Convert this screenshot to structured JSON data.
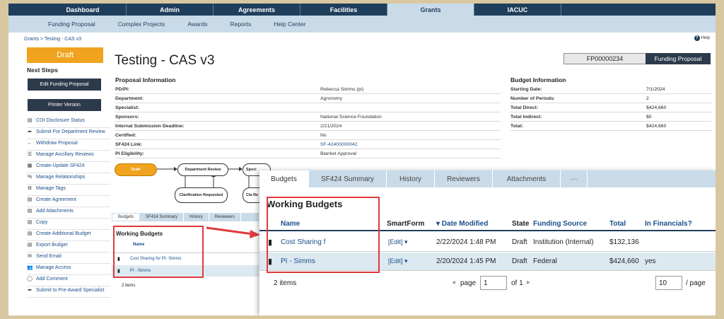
{
  "topnav": [
    "Dashboard",
    "Admin",
    "Agreements",
    "Facilities",
    "Grants",
    "IACUC"
  ],
  "topnav_active": 4,
  "subnav": [
    "Funding Proposal",
    "Complex Projects",
    "Awards",
    "Reports",
    "Help Center"
  ],
  "breadcrumb": "Grants  >  Testing - CAS v3",
  "help": "Help",
  "state": "Draft",
  "next_steps": "Next Steps",
  "edit_btn": "Edit Funding Proposal",
  "printer_btn": "Printer Version",
  "actions": [
    {
      "icon": "▤",
      "label": "COI Disclosure Status"
    },
    {
      "icon": "➦",
      "label": "Submit For Department Review"
    },
    {
      "icon": "←",
      "label": "Withdraw Proposal"
    },
    {
      "icon": "☰",
      "label": "Manage Ancillary Reviews"
    },
    {
      "icon": "▦",
      "label": "Create-Update SF424"
    },
    {
      "icon": "%",
      "label": "Manage Relationships"
    },
    {
      "icon": "⚙",
      "label": "Manage Tags"
    },
    {
      "icon": "▤",
      "label": "Create Agreement"
    },
    {
      "icon": "▤",
      "label": "Add Attachments"
    },
    {
      "icon": "▤",
      "label": "Copy"
    },
    {
      "icon": "▤",
      "label": "Create Additional Budget"
    },
    {
      "icon": "▤",
      "label": "Export Budget"
    },
    {
      "icon": "✉",
      "label": "Send Email"
    },
    {
      "icon": "👥",
      "label": "Manage Access"
    },
    {
      "icon": "◯",
      "label": "Add Comment"
    },
    {
      "icon": "➦",
      "label": "Submit to Pre-Award Specialist"
    }
  ],
  "title": "Testing - CAS v3",
  "proposal_id": "FP00000234",
  "proposal_type": "Funding Proposal",
  "proposal_info": {
    "heading": "Proposal Information",
    "rows": [
      {
        "k": "PD/PI:",
        "v": "Rebecca Simms (pi)",
        "link": false
      },
      {
        "k": "Department:",
        "v": "Agronomy",
        "link": false
      },
      {
        "k": "Specialist:",
        "v": "",
        "link": false
      },
      {
        "k": "Sponsors:",
        "v": "National Science Foundation",
        "link": false
      },
      {
        "k": "Internal Submission Deadline:",
        "v": "2/21/2024",
        "link": false
      },
      {
        "k": "Certified:",
        "v": "No",
        "link": false
      },
      {
        "k": "SF424 Link:",
        "v": "SF-42400000042",
        "link": true
      },
      {
        "k": "PI Eligibility:",
        "v": "Blanket Approval",
        "link": false
      }
    ]
  },
  "budget_info": {
    "heading": "Budget Information",
    "rows": [
      {
        "k": "Starting Date:",
        "v": "7/1/2024"
      },
      {
        "k": "Number of Periods:",
        "v": "2"
      },
      {
        "k": "Total Direct:",
        "v": "$424,660"
      },
      {
        "k": "Total Indirect:",
        "v": "$0"
      },
      {
        "k": "Total:",
        "v": "$424,660"
      }
    ]
  },
  "workflow": {
    "draft": "Draft",
    "dept_review": "Department Review",
    "special": "Speci",
    "clarification": "Clarification Requested",
    "clar2": "Cla Re"
  },
  "small_tabs": [
    "Budgets",
    "SF424 Summary",
    "History",
    "Reviewers"
  ],
  "small_heading": "Working Budgets",
  "small_name_col": "Name",
  "small_rows": [
    "Cost Sharing for PI- Simms",
    "PI - Simms"
  ],
  "small_count": "2 items",
  "big_tabs": [
    "Budgets",
    "SF424 Summary",
    "History",
    "Reviewers",
    "Attachments",
    "···"
  ],
  "big_heading": "Working Budgets",
  "columns": {
    "name": "Name",
    "smartform": "SmartForm",
    "date": "▾ Date Modified",
    "state": "State",
    "source": "Funding Source",
    "total": "Total",
    "fin": "In Financials?"
  },
  "rows": [
    {
      "name": "Cost Sharing f",
      "edit": "[Edit] ▾",
      "date": "2/22/2024 1:48 PM",
      "state": "Draft",
      "source": "Institution (Internal)",
      "total": "$132,136",
      "fin": ""
    },
    {
      "name": "PI - Simms",
      "edit": "[Edit] ▾",
      "date": "2/20/2024 1:45 PM",
      "state": "Draft",
      "source": "Federal",
      "total": "$424,660",
      "fin": "yes"
    }
  ],
  "pager": {
    "count": "2 items",
    "page_label": "page",
    "page": "1",
    "of": "of 1",
    "per_page": "10",
    "per_page_label": "/ page"
  },
  "colors": {
    "nav": "#1f3e5b",
    "accent": "#f0a31e",
    "highlight": "#e0393e"
  }
}
